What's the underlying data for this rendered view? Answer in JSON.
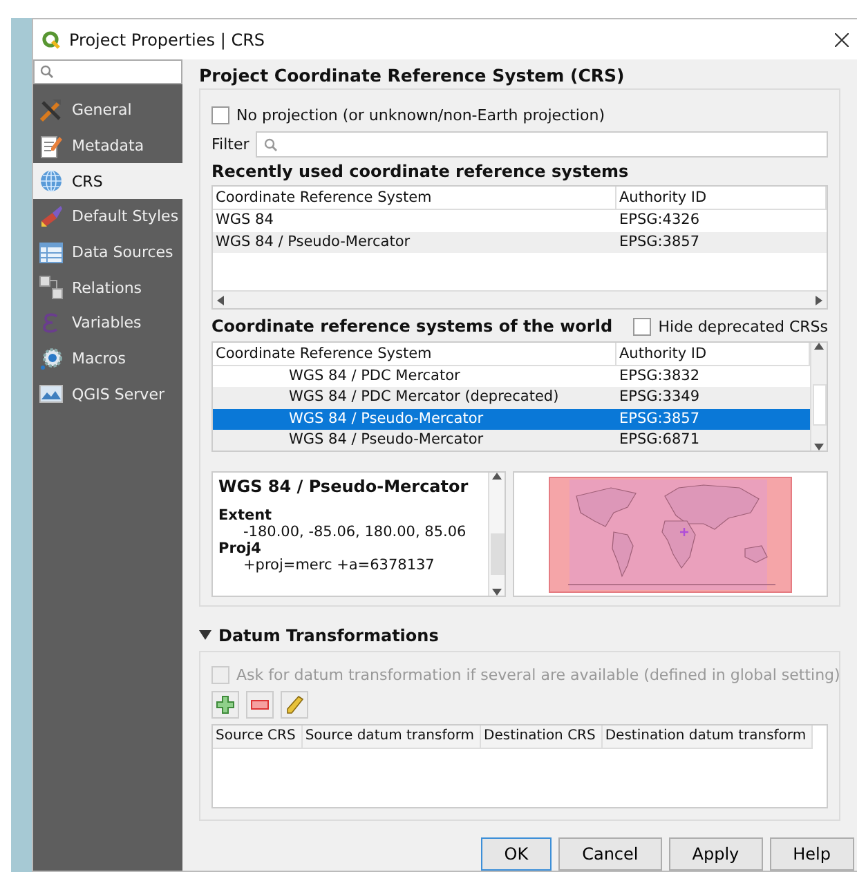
{
  "window": {
    "title": "Project Properties | CRS"
  },
  "sidebar": {
    "items": [
      {
        "label": "General",
        "selected": false
      },
      {
        "label": "Metadata",
        "selected": false
      },
      {
        "label": "CRS",
        "selected": true
      },
      {
        "label": "Default Styles",
        "selected": false
      },
      {
        "label": "Data Sources",
        "selected": false
      },
      {
        "label": "Relations",
        "selected": false
      },
      {
        "label": "Variables",
        "selected": false
      },
      {
        "label": "Macros",
        "selected": false
      },
      {
        "label": "QGIS Server",
        "selected": false
      }
    ]
  },
  "crs": {
    "title": "Project Coordinate Reference System (CRS)",
    "no_projection": {
      "label": "No projection (or unknown/non-Earth projection)",
      "checked": false
    },
    "filter": {
      "label": "Filter"
    },
    "recent": {
      "title": "Recently used coordinate reference systems",
      "columns": [
        "Coordinate Reference System",
        "Authority ID"
      ],
      "rows": [
        {
          "name": "WGS 84",
          "id": "EPSG:4326"
        },
        {
          "name": "WGS 84 / Pseudo-Mercator",
          "id": "EPSG:3857"
        }
      ]
    },
    "world": {
      "title": "Coordinate reference systems of the world",
      "hide_deprecated": {
        "label": "Hide deprecated CRSs",
        "checked": false
      },
      "columns": [
        "Coordinate Reference System",
        "Authority ID"
      ],
      "rows": [
        {
          "name": "WGS 84 / PDC Mercator",
          "id": "EPSG:3832",
          "selected": false
        },
        {
          "name": "WGS 84 / PDC Mercator (deprecated)",
          "id": "EPSG:3349",
          "selected": false
        },
        {
          "name": "WGS 84 / Pseudo-Mercator",
          "id": "EPSG:3857",
          "selected": true
        },
        {
          "name": "WGS 84 / Pseudo-Mercator",
          "id": "EPSG:6871",
          "selected": false
        }
      ]
    },
    "details": {
      "title": "WGS 84 / Pseudo-Mercator",
      "sections": [
        {
          "heading": "Extent",
          "value": "-180.00, -85.06, 180.00, 85.06"
        },
        {
          "heading": "Proj4",
          "value": "+proj=merc +a=6378137"
        }
      ]
    }
  },
  "datum": {
    "title": "Datum Transformations",
    "expanded": true,
    "ask": {
      "label": "Ask for datum transformation if several are available (defined in global setting)",
      "checked": false,
      "disabled": true
    },
    "columns": [
      "Source CRS",
      "Source datum transform",
      "Destination CRS",
      "Destination datum transform"
    ]
  },
  "buttons": [
    {
      "label": "OK",
      "selected": true
    },
    {
      "label": "Cancel",
      "selected": false
    },
    {
      "label": "Apply",
      "selected": false
    },
    {
      "label": "Help",
      "selected": false
    }
  ]
}
